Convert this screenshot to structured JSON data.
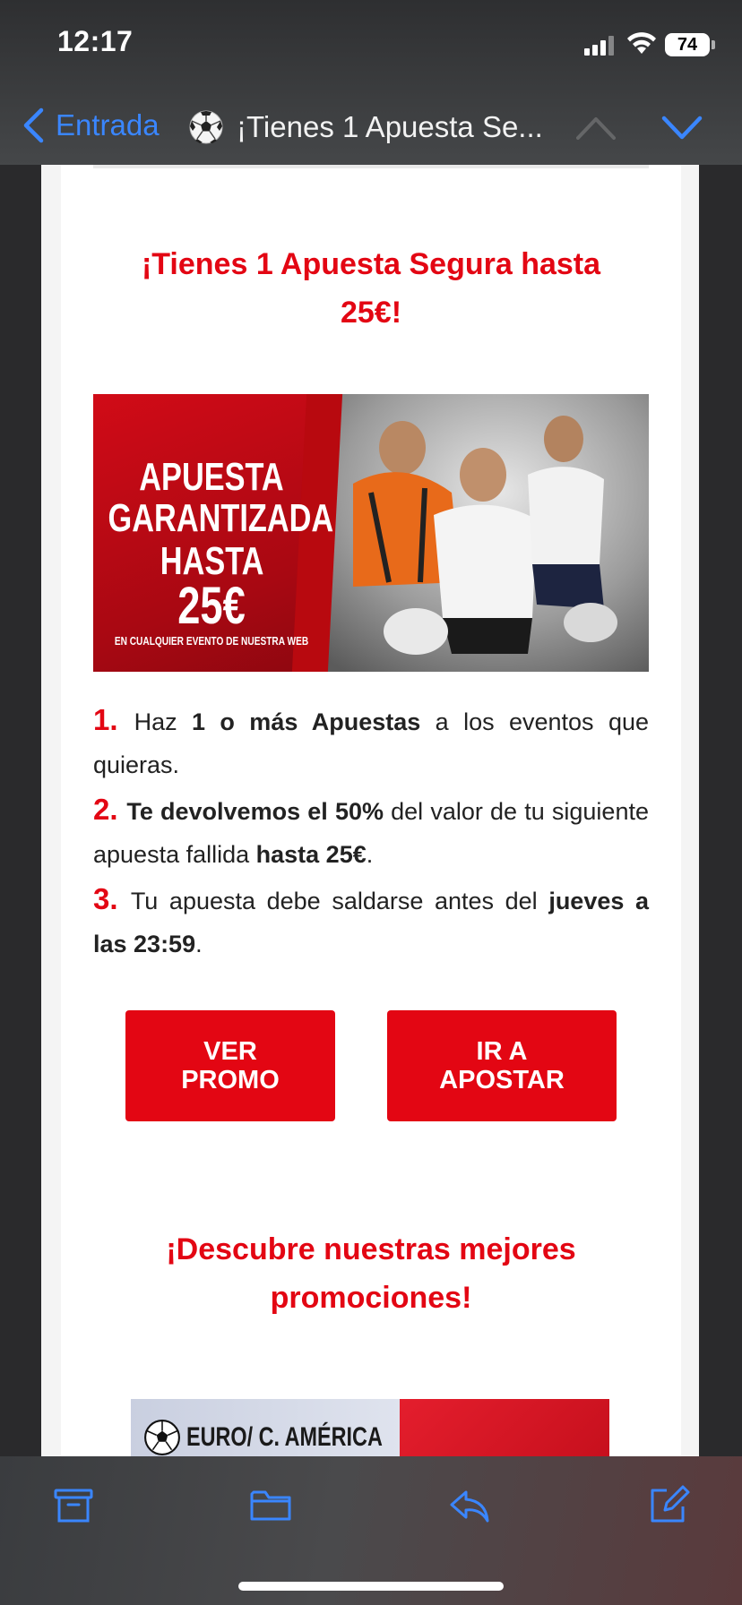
{
  "status_bar": {
    "time": "12:17",
    "battery": "74"
  },
  "nav": {
    "back_label": "Entrada",
    "title": "¡Tienes 1 Apuesta Se..."
  },
  "email": {
    "headline": "¡Tienes 1 Apuesta Segura hasta 25€!",
    "banner": {
      "line1": "APUESTA",
      "line2": "GARANTIZADA",
      "line3_prefix": "HASTA",
      "line3_amount": "25€",
      "line4": "EN CUALQUIER EVENTO DE NUESTRA WEB"
    },
    "steps": [
      {
        "num": "1.",
        "parts": [
          [
            "",
            "Haz "
          ],
          [
            "b",
            "1 o más Apuestas"
          ],
          [
            "",
            " a los eventos que quieras."
          ]
        ]
      },
      {
        "num": "2.",
        "parts": [
          [
            "b",
            "Te devolvemos el 50%"
          ],
          [
            "",
            " del valor de tu siguiente apuesta fallida "
          ],
          [
            "b",
            "hasta 25€"
          ],
          [
            "",
            "."
          ]
        ]
      },
      {
        "num": "3.",
        "parts": [
          [
            "",
            "Tu apuesta debe saldarse antes del "
          ],
          [
            "b",
            "jueves a las 23:59"
          ],
          [
            "",
            "."
          ]
        ]
      }
    ],
    "buttons": {
      "promo_line1": "VER",
      "promo_line2": "PROMO",
      "apostar_line1": "IR A",
      "apostar_line2": "APOSTAR"
    },
    "subheadline": "¡Descubre nuestras mejores promociones!",
    "promo_banner_text": "EURO/ C. AMÉRICA"
  },
  "colors": {
    "brand_red": "#e30613",
    "ios_blue": "#3a86ff"
  },
  "toolbar_icons": [
    "archive-icon",
    "folder-icon",
    "reply-icon",
    "compose-icon"
  ]
}
